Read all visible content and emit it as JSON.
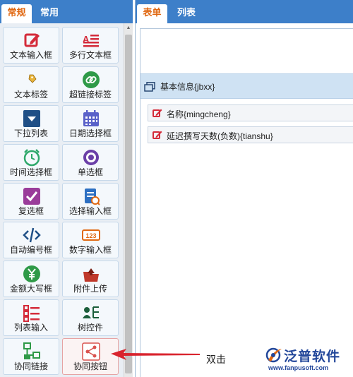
{
  "left_panel": {
    "tabs": [
      {
        "label": "常规",
        "active": true
      },
      {
        "label": "常用",
        "active": false
      }
    ],
    "palette": [
      {
        "label": "文本输入框",
        "icon": "edit-box-icon",
        "color": "#d42b3a"
      },
      {
        "label": "多行文本框",
        "icon": "multiline-text-icon",
        "color": "#d42b3a"
      },
      {
        "label": "文本标签",
        "icon": "tag-icon",
        "color": "#e8b43a"
      },
      {
        "label": "超链接标签",
        "icon": "link-icon",
        "color": "#2f9a48"
      },
      {
        "label": "下拉列表",
        "icon": "dropdown-icon",
        "color": "#1f4f86"
      },
      {
        "label": "日期选择框",
        "icon": "calendar-icon",
        "color": "#5a62c9"
      },
      {
        "label": "时间选择框",
        "icon": "alarm-clock-icon",
        "color": "#2fa86b"
      },
      {
        "label": "单选框",
        "icon": "radio-icon",
        "color": "#6a3fa7"
      },
      {
        "label": "复选框",
        "icon": "checkbox-icon",
        "color": "#9a3c9a"
      },
      {
        "label": "选择输入框",
        "icon": "select-input-icon",
        "color": "#2d6fc2"
      },
      {
        "label": "自动编号框",
        "icon": "code-icon",
        "color": "#1f4f86"
      },
      {
        "label": "数字输入框",
        "icon": "number-123-icon",
        "color": "#e06812"
      },
      {
        "label": "金额大写框",
        "icon": "yuan-coin-icon",
        "color": "#2f9a48"
      },
      {
        "label": "附件上传",
        "icon": "upload-folder-icon",
        "color": "#c0392b"
      },
      {
        "label": "列表输入",
        "icon": "list-icon",
        "color": "#d42b3a"
      },
      {
        "label": "树控件",
        "icon": "tree-user-icon",
        "color": "#1b5e3b"
      },
      {
        "label": "协同链接",
        "icon": "network-link-icon",
        "color": "#2f9a48"
      },
      {
        "label": "协同按钮",
        "icon": "share-icon",
        "color": "#d9534f"
      }
    ]
  },
  "right_panel": {
    "tabs": [
      {
        "label": "表单",
        "active": true
      },
      {
        "label": "列表",
        "active": false
      }
    ],
    "section": {
      "label": "基本信息{jbxx}",
      "icon": "copy-window-icon"
    },
    "fields": [
      {
        "label": "名称{mingcheng}",
        "icon": "edit-box-icon"
      },
      {
        "label": "延迟撰写天数(负数){tianshu}",
        "icon": "edit-box-icon"
      }
    ]
  },
  "annotation": {
    "text": "双击",
    "arrow_color": "#d9242e"
  },
  "logo": {
    "name": "泛普软件",
    "url": "www.fanpusoft.com",
    "icon": "fanpu-logo-icon"
  },
  "colors": {
    "tab_bar": "#3d7fc9",
    "active_tab_text": "#e06812",
    "panel_bg": "#e9eef4",
    "section_bg": "#cfe2f3",
    "logo_blue": "#23479a"
  }
}
